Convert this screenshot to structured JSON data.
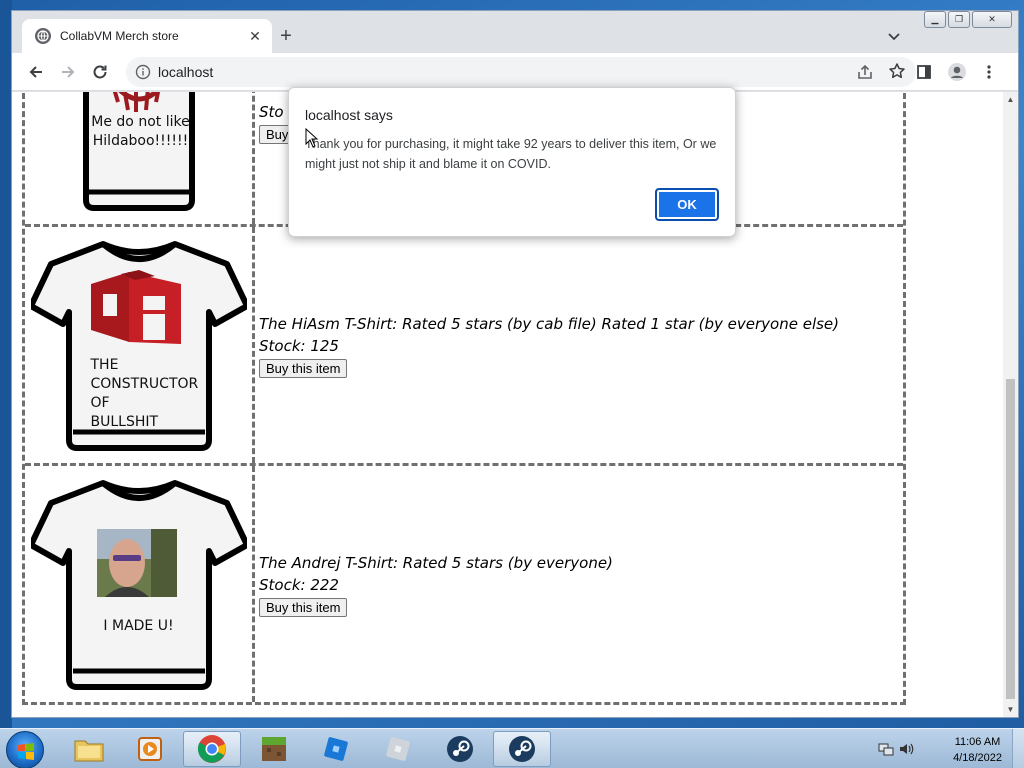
{
  "browser": {
    "tab_title": "CollabVM Merch store",
    "url": "localhost"
  },
  "alert": {
    "title": "localhost says",
    "message": "Thank you for purchasing, it might take 92 years to deliver this item, Or we might just not ship it and blame it on COVID.",
    "ok_label": "OK"
  },
  "products": [
    {
      "title_partial": "",
      "stock_partial": "Sto",
      "buy_label_partial": "Buy",
      "shirt_caption_lines": [
        "Me do not like",
        "Hildaboo!!!!!!"
      ]
    },
    {
      "title": "The HiAsm T-Shirt: Rated 5 stars (by cab file) Rated 1 star (by everyone else)",
      "stock": "Stock: 125",
      "buy_label": "Buy this item",
      "shirt_caption_lines": [
        "THE",
        "CONSTRUCTOR",
        "OF",
        "BULLSHIT"
      ],
      "shirt_logo": "hiasm-cube-logo"
    },
    {
      "title": "The Andrej T-Shirt: Rated 5 stars (by everyone)",
      "stock": "Stock: 222",
      "buy_label": "Buy this item",
      "shirt_caption_lines": [
        "I MADE U!"
      ],
      "shirt_photo": "portrait-photo"
    }
  ],
  "taskbar": {
    "apps": [
      "explorer-icon",
      "media-player-icon",
      "chrome-icon",
      "minecraft-icon",
      "roblox-icon",
      "roblox-studio-icon",
      "steam-icon",
      "steam-icon"
    ],
    "time": "11:06 AM",
    "date": "4/18/2022"
  },
  "colors": {
    "accent": "#1a73e8",
    "shirt_red": "#b01e23"
  }
}
